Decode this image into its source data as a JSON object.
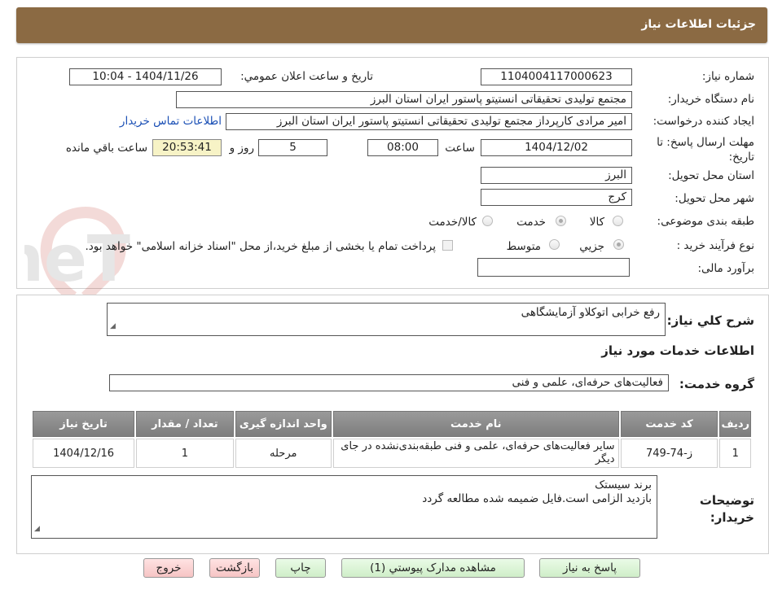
{
  "header": {
    "title": "جزئیات اطلاعات نیاز"
  },
  "watermark": {
    "text": "AriaTender.neT"
  },
  "fields": {
    "need_number": {
      "label": "شماره نیاز:",
      "value": "1104004117000623"
    },
    "announce_datetime": {
      "label": "تاریخ و ساعت اعلان عمومي:",
      "value": "1404/11/26 - 10:04"
    },
    "buyer_org": {
      "label": "نام دستگاه خريدار:",
      "value": "مجتمع تولیدی تحقیقاتی انستیتو پاستور ایران استان البرز"
    },
    "requester": {
      "label": "ايجاد کننده درخواست:",
      "value": "امیر مرادی کارپرداز مجتمع تولیدی تحقیقاتی انستیتو پاستور ایران استان البرز"
    },
    "buyer_contact_link": "اطلاعات تماس خريدار",
    "deadline": {
      "label": "مهلت ارسال پاسخ: تا تاریخ:",
      "date": "1404/12/02",
      "time_label": "ساعت",
      "time": "08:00",
      "days": "5",
      "days_label": "روز و",
      "remaining": "20:53:41",
      "remaining_label": "ساعت باقي مانده"
    },
    "province": {
      "label": "استان محل تحويل:",
      "value": "البرز"
    },
    "city": {
      "label": "شهر محل تحويل:",
      "value": "کرج"
    },
    "category": {
      "label": "طبقه بندی موضوعی:",
      "options": [
        {
          "label": "کالا",
          "checked": false
        },
        {
          "label": "خدمت",
          "checked": true
        },
        {
          "label": "کالا/خدمت",
          "checked": false
        }
      ]
    },
    "purchase_process": {
      "label": "نوع فرآیند خرید :",
      "options": [
        {
          "label": "جزیي",
          "checked": true
        },
        {
          "label": "متوسط",
          "checked": false
        }
      ],
      "note": "پرداخت تمام یا بخشی از مبلغ خرید،از محل \"اسناد خزانه اسلامی\" خواهد بود."
    },
    "budget": {
      "label": "برآورد مالی:",
      "value": ""
    }
  },
  "general_description": {
    "label": "شرح کلي نياز:",
    "value": "رفع خرابی اتوکلاو آزمایشگاهی"
  },
  "services_section": {
    "title": "اطلاعات خدمات مورد نياز"
  },
  "service_group": {
    "label": "گروه خدمت:",
    "value": "فعالیت‌های حرفه‌ای، علمی و فنی"
  },
  "table": {
    "headers": [
      "رديف",
      "کد خدمت",
      "نام خدمت",
      "واحد اندازه گيری",
      "تعداد / مقدار",
      "تاريخ نياز"
    ],
    "rows": [
      [
        "1",
        "ز-74-749",
        "سایر فعالیت‌های حرفه‌ای، علمی و فنی طبقه‌بندی‌نشده در جای دیگر",
        "مرحله",
        "1",
        "1404/12/16"
      ]
    ]
  },
  "buyer_notes": {
    "label": "توضيحات خريدار:",
    "lines": [
      "برند سیستک",
      "بازدید الزامی است.فایل ضمیمه شده مطالعه گردد"
    ]
  },
  "buttons": {
    "reply": "پاسخ به نياز",
    "attachments": "مشاهده مدارک پیوستي (1)",
    "print": "چاپ",
    "back": "بازگشت",
    "exit": "خروج"
  }
}
